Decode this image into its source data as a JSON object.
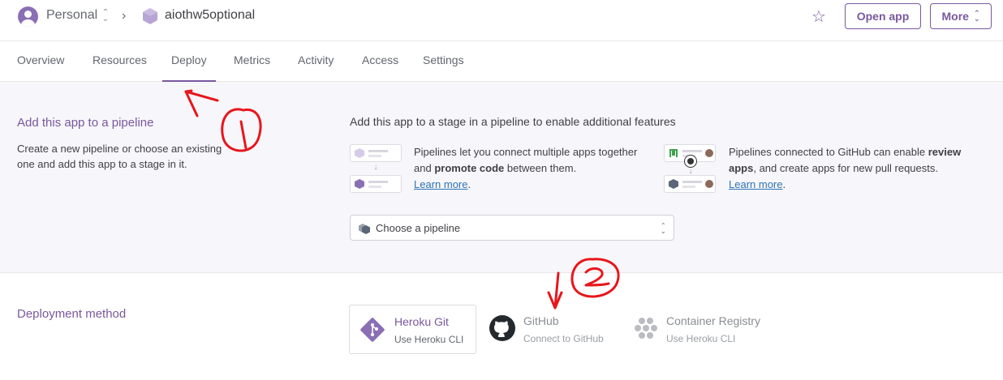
{
  "header": {
    "account": "Personal",
    "app_name": "aiothw5optional",
    "open_app": "Open app",
    "more": "More"
  },
  "tabs": [
    "Overview",
    "Resources",
    "Deploy",
    "Metrics",
    "Activity",
    "Access",
    "Settings"
  ],
  "active_tab": "Deploy",
  "pipeline": {
    "title": "Add this app to a pipeline",
    "description": "Create a new pipeline or choose an existing one and add this app to a stage in it.",
    "heading": "Add this app to a stage in a pipeline to enable additional features",
    "feature1": {
      "text_a": "Pipelines let you connect multiple apps together and ",
      "bold": "promote code",
      "text_b": " between them.",
      "learn_more": "Learn more"
    },
    "feature2": {
      "text_a": "Pipelines connected to GitHub can enable ",
      "bold": "review apps",
      "text_b": ", and create apps for new pull requests.",
      "learn_more": "Learn more"
    },
    "select_placeholder": "Choose a pipeline"
  },
  "deployment": {
    "title": "Deployment method",
    "methods": [
      {
        "name": "Heroku Git",
        "sub": "Use Heroku CLI"
      },
      {
        "name": "GitHub",
        "sub": "Connect to GitHub"
      },
      {
        "name": "Container Registry",
        "sub": "Use Heroku CLI"
      }
    ]
  },
  "colors": {
    "brand_purple": "#79589f",
    "link_blue": "#2d73b5",
    "annotation_red": "#e8161b"
  }
}
